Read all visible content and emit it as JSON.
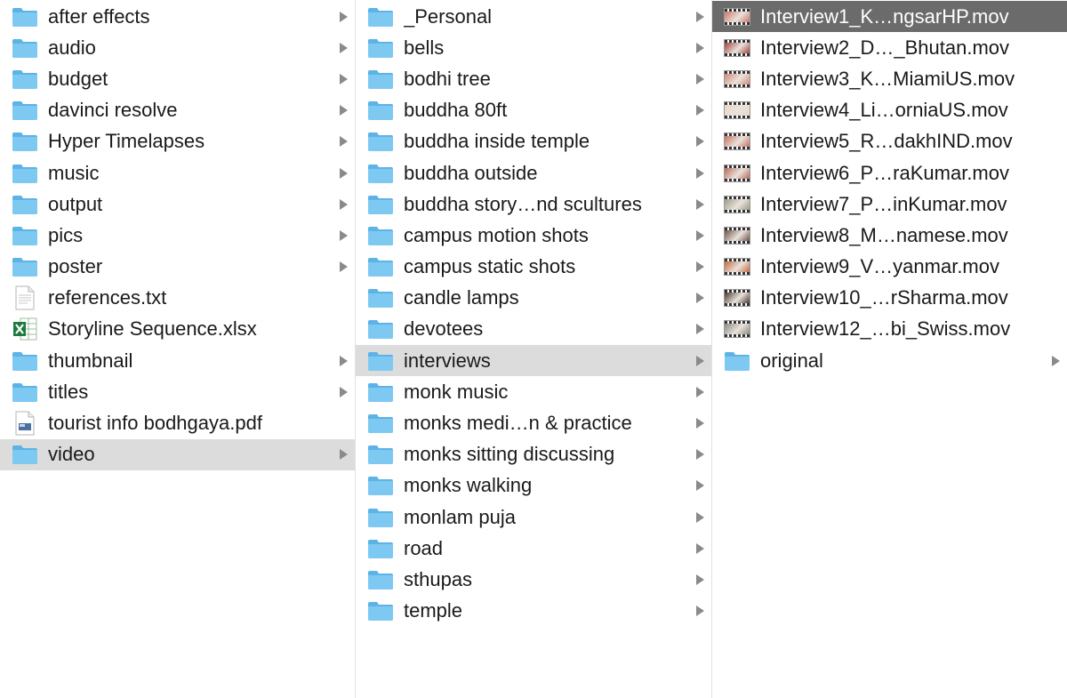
{
  "colors": {
    "folder": "#7ec9f2",
    "folder_tab": "#5cb3e6",
    "selected_inactive": "#dcdcdc",
    "selected_active": "#6b6b6b",
    "chevron": "#8a8a8a"
  },
  "columns": [
    {
      "items": [
        {
          "label": "after effects",
          "icon": "folder-icon",
          "chevron": true,
          "state": ""
        },
        {
          "label": "audio",
          "icon": "folder-icon",
          "chevron": true,
          "state": ""
        },
        {
          "label": "budget",
          "icon": "folder-icon",
          "chevron": true,
          "state": ""
        },
        {
          "label": "davinci resolve",
          "icon": "folder-icon",
          "chevron": true,
          "state": ""
        },
        {
          "label": "Hyper Timelapses",
          "icon": "folder-icon",
          "chevron": true,
          "state": ""
        },
        {
          "label": "music",
          "icon": "folder-icon",
          "chevron": true,
          "state": ""
        },
        {
          "label": "output",
          "icon": "folder-icon",
          "chevron": true,
          "state": ""
        },
        {
          "label": "pics",
          "icon": "folder-icon",
          "chevron": true,
          "state": ""
        },
        {
          "label": "poster",
          "icon": "folder-icon",
          "chevron": true,
          "state": ""
        },
        {
          "label": "references.txt",
          "icon": "text-file-icon",
          "chevron": false,
          "state": ""
        },
        {
          "label": "Storyline Sequence.xlsx",
          "icon": "excel-file-icon",
          "chevron": false,
          "state": ""
        },
        {
          "label": "thumbnail",
          "icon": "folder-icon",
          "chevron": true,
          "state": ""
        },
        {
          "label": "titles",
          "icon": "folder-icon",
          "chevron": true,
          "state": ""
        },
        {
          "label": "tourist info bodhgaya.pdf",
          "icon": "pdf-file-icon",
          "chevron": false,
          "state": ""
        },
        {
          "label": "video",
          "icon": "folder-icon",
          "chevron": true,
          "state": "selected-inactive"
        }
      ]
    },
    {
      "items": [
        {
          "label": "_Personal",
          "icon": "folder-icon",
          "chevron": true,
          "state": ""
        },
        {
          "label": "bells",
          "icon": "folder-icon",
          "chevron": true,
          "state": ""
        },
        {
          "label": "bodhi tree",
          "icon": "folder-icon",
          "chevron": true,
          "state": ""
        },
        {
          "label": "buddha 80ft",
          "icon": "folder-icon",
          "chevron": true,
          "state": ""
        },
        {
          "label": "buddha inside temple",
          "icon": "folder-icon",
          "chevron": true,
          "state": ""
        },
        {
          "label": "buddha outside",
          "icon": "folder-icon",
          "chevron": true,
          "state": ""
        },
        {
          "label": "buddha story…nd scultures",
          "icon": "folder-icon",
          "chevron": true,
          "state": ""
        },
        {
          "label": "campus motion shots",
          "icon": "folder-icon",
          "chevron": true,
          "state": ""
        },
        {
          "label": "campus static shots",
          "icon": "folder-icon",
          "chevron": true,
          "state": ""
        },
        {
          "label": "candle lamps",
          "icon": "folder-icon",
          "chevron": true,
          "state": ""
        },
        {
          "label": "devotees",
          "icon": "folder-icon",
          "chevron": true,
          "state": ""
        },
        {
          "label": "interviews",
          "icon": "folder-icon",
          "chevron": true,
          "state": "selected-inactive"
        },
        {
          "label": "monk music",
          "icon": "folder-icon",
          "chevron": true,
          "state": ""
        },
        {
          "label": "monks medi…n & practice",
          "icon": "folder-icon",
          "chevron": true,
          "state": ""
        },
        {
          "label": "monks sitting discussing",
          "icon": "folder-icon",
          "chevron": true,
          "state": ""
        },
        {
          "label": "monks walking",
          "icon": "folder-icon",
          "chevron": true,
          "state": ""
        },
        {
          "label": "monlam puja",
          "icon": "folder-icon",
          "chevron": true,
          "state": ""
        },
        {
          "label": "road",
          "icon": "folder-icon",
          "chevron": true,
          "state": ""
        },
        {
          "label": "sthupas",
          "icon": "folder-icon",
          "chevron": true,
          "state": ""
        },
        {
          "label": "temple",
          "icon": "folder-icon",
          "chevron": true,
          "state": ""
        }
      ]
    },
    {
      "items": [
        {
          "label": "Interview1_K…ngsarHP.mov",
          "icon": "video-thumbnail-icon",
          "thumb_color": "#c9756a",
          "chevron": false,
          "state": "selected-active"
        },
        {
          "label": "Interview2_D…_Bhutan.mov",
          "icon": "video-thumbnail-icon",
          "thumb_color": "#a0443a",
          "chevron": false,
          "state": ""
        },
        {
          "label": "Interview3_K…MiamiUS.mov",
          "icon": "video-thumbnail-icon",
          "thumb_color": "#d08a7a",
          "chevron": false,
          "state": ""
        },
        {
          "label": "Interview4_Li…orniaUS.mov",
          "icon": "video-thumbnail-icon",
          "thumb_color": "#e8d8c8",
          "chevron": false,
          "state": ""
        },
        {
          "label": "Interview5_R…dakhIND.mov",
          "icon": "video-thumbnail-icon",
          "thumb_color": "#c87060",
          "chevron": false,
          "state": ""
        },
        {
          "label": "Interview6_P…raKumar.mov",
          "icon": "video-thumbnail-icon",
          "thumb_color": "#b86a5a",
          "chevron": false,
          "state": ""
        },
        {
          "label": "Interview7_P…inKumar.mov",
          "icon": "video-thumbnail-icon",
          "thumb_color": "#9a9a8a",
          "chevron": false,
          "state": ""
        },
        {
          "label": "Interview8_M…namese.mov",
          "icon": "video-thumbnail-icon",
          "thumb_color": "#6a5048",
          "chevron": false,
          "state": ""
        },
        {
          "label": "Interview9_V…yanmar.mov",
          "icon": "video-thumbnail-icon",
          "thumb_color": "#c06a40",
          "chevron": false,
          "state": ""
        },
        {
          "label": "Interview10_…rSharma.mov",
          "icon": "video-thumbnail-icon",
          "thumb_color": "#4a3830",
          "chevron": false,
          "state": ""
        },
        {
          "label": "Interview12_…bi_Swiss.mov",
          "icon": "video-thumbnail-icon",
          "thumb_color": "#8a8a80",
          "chevron": false,
          "state": ""
        },
        {
          "label": "original",
          "icon": "folder-icon",
          "chevron": true,
          "state": ""
        }
      ]
    }
  ]
}
